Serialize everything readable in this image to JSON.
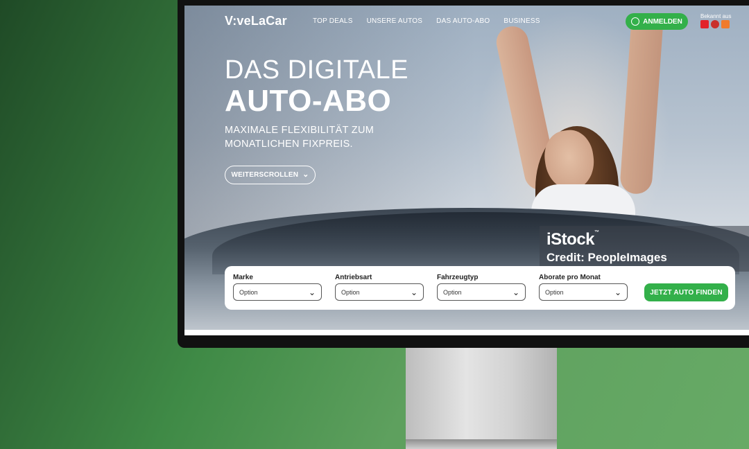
{
  "brand": {
    "logo_text": "V:veLaCar"
  },
  "nav": {
    "items": [
      "TOP DEALS",
      "UNSERE AUTOS",
      "DAS AUTO-ABO",
      "BUSINESS"
    ]
  },
  "header": {
    "login_label": "ANMELDEN",
    "known_from_label": "Bekannt aus"
  },
  "hero": {
    "title_line1": "DAS DIGITALE",
    "title_line2": "AUTO-ABO",
    "subtitle": "MAXIMALE FLEXIBILITÄT ZUM MONATLICHEN FIXPREIS.",
    "scroll_button": "WEITERSCROLLEN"
  },
  "image_credit": {
    "source": "iStock",
    "credit": "Credit: PeopleImages"
  },
  "search": {
    "fields": [
      {
        "label": "Marke",
        "value": "Option"
      },
      {
        "label": "Antriebsart",
        "value": "Option"
      },
      {
        "label": "Fahrzeugtyp",
        "value": "Option"
      },
      {
        "label": "Aborate pro Monat",
        "value": "Option"
      }
    ],
    "submit_label": "JETZT AUTO FINDEN"
  },
  "colors": {
    "accent_green": "#33b04a",
    "background_green": "#5ea05e"
  }
}
